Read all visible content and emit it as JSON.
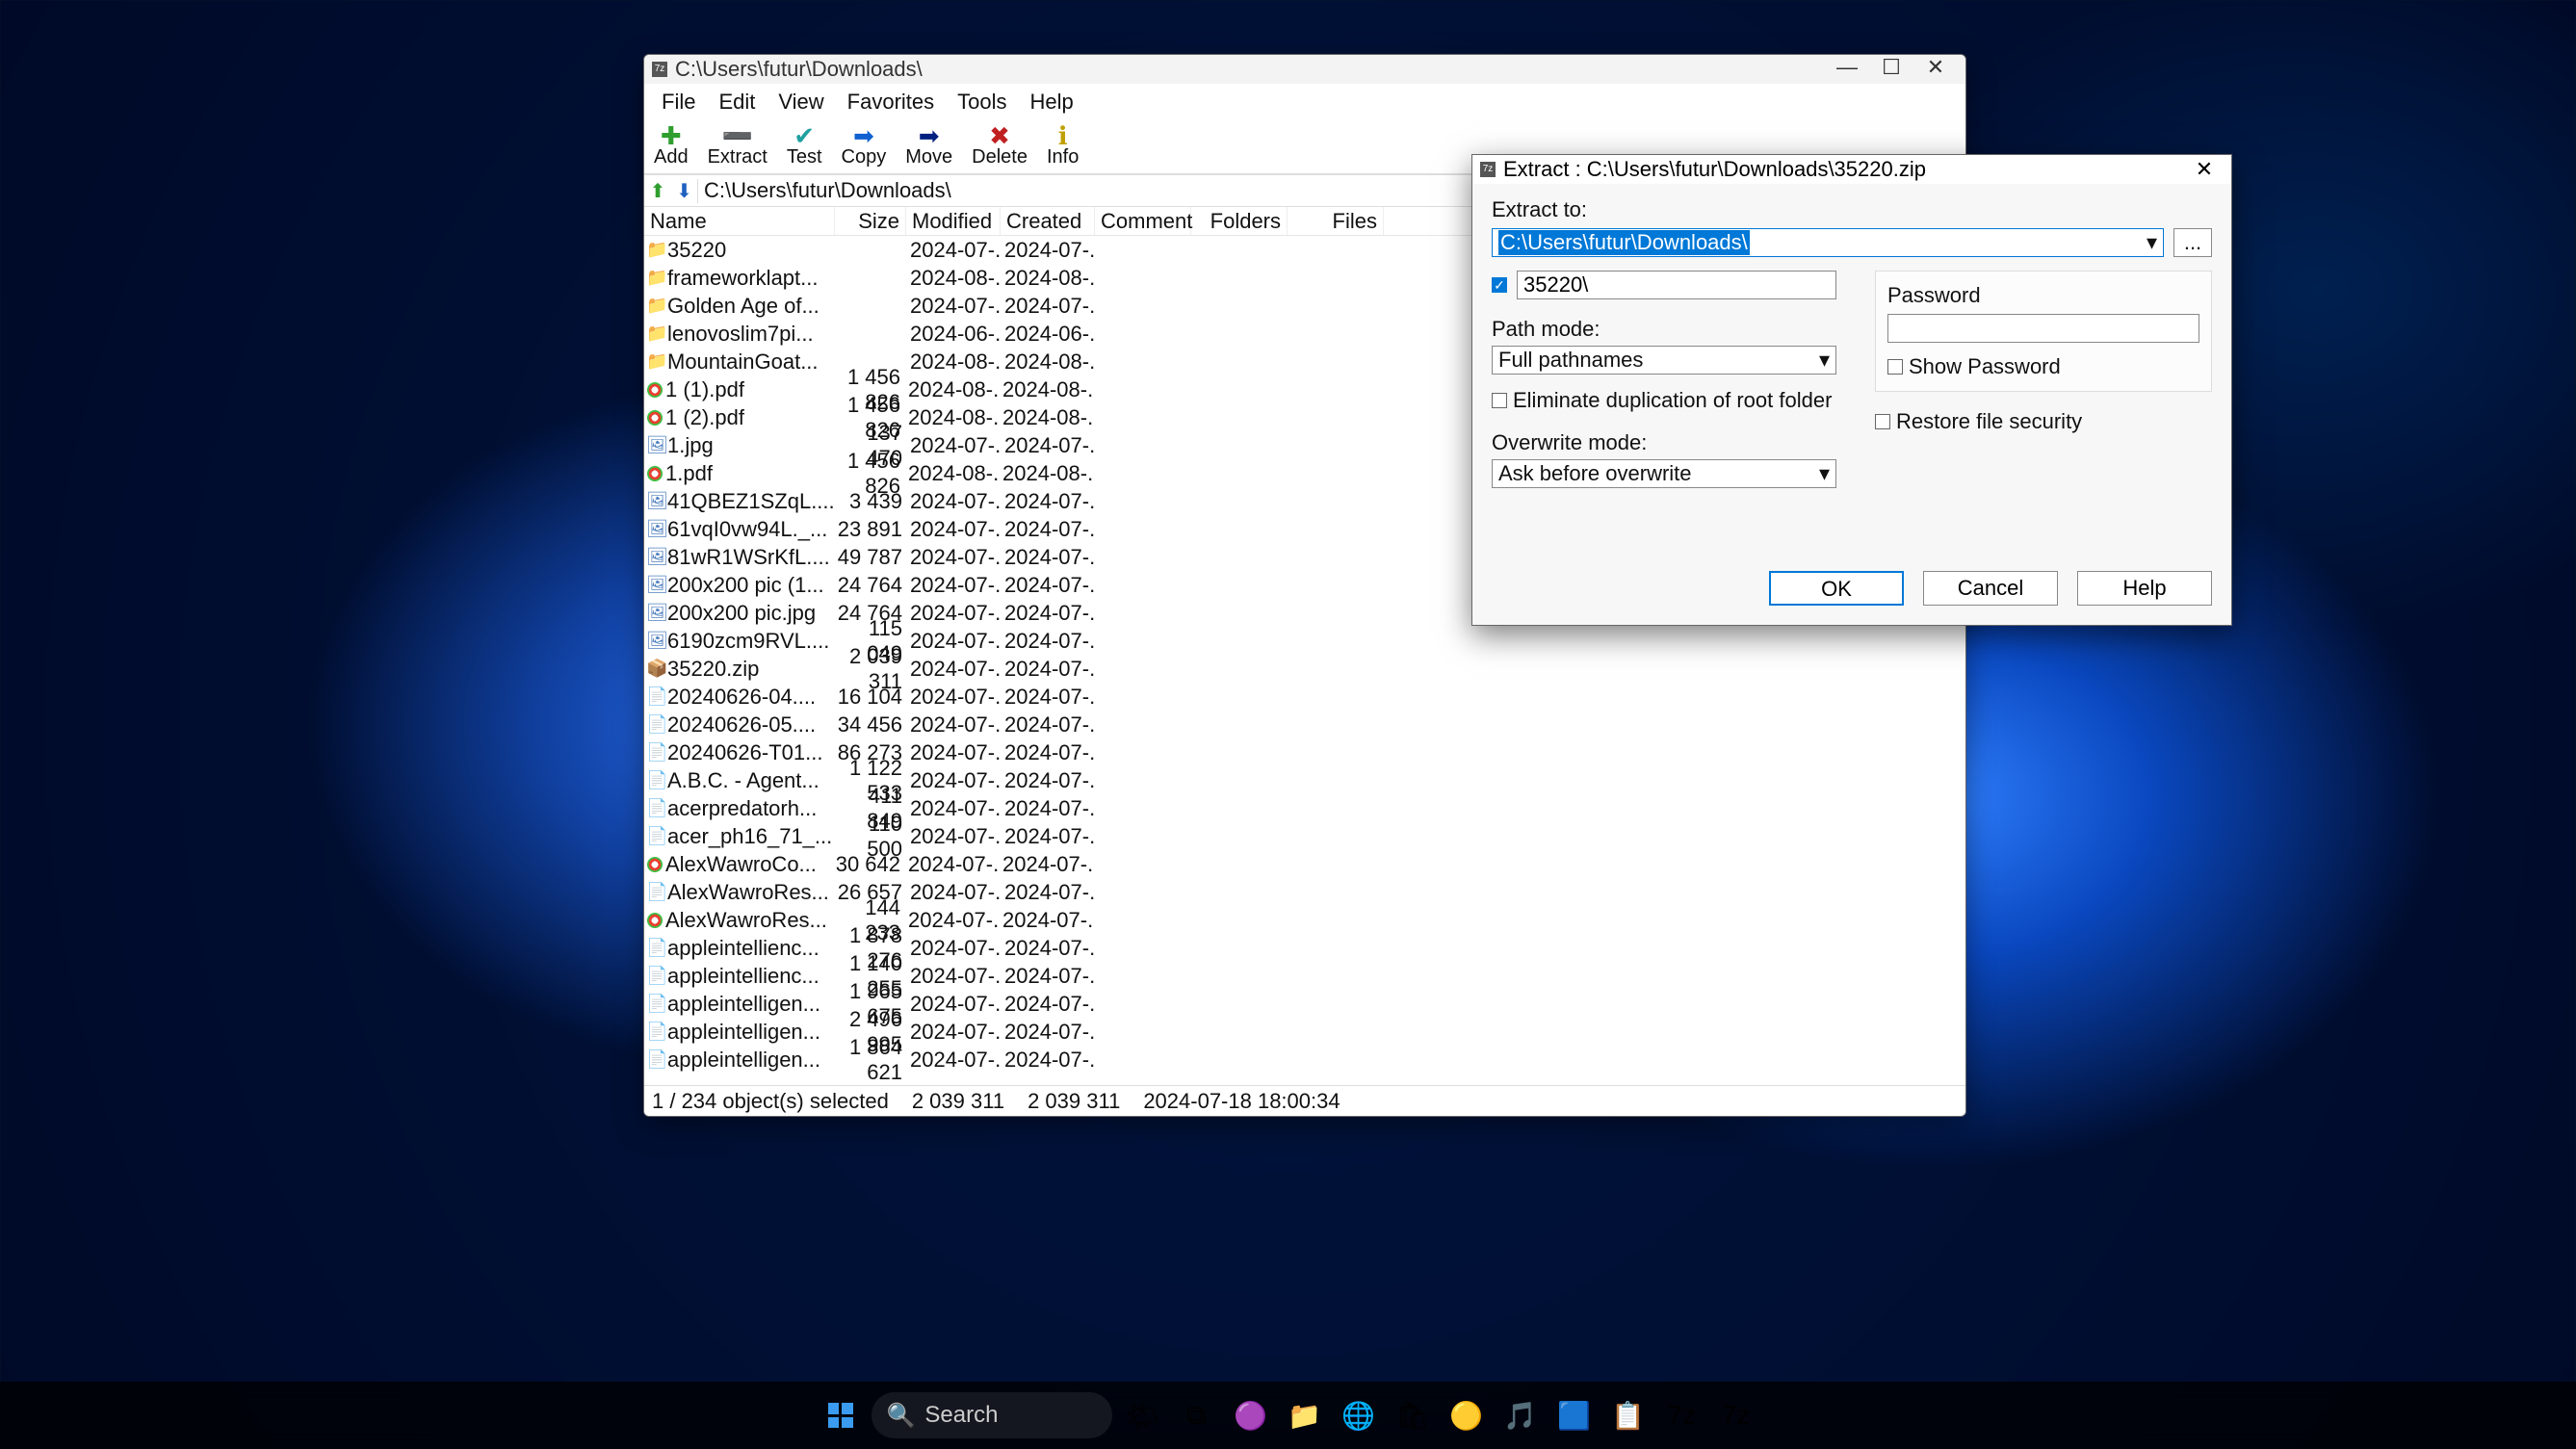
{
  "main": {
    "title": "C:\\Users\\futur\\Downloads\\",
    "menus": [
      "File",
      "Edit",
      "View",
      "Favorites",
      "Tools",
      "Help"
    ],
    "toolbar": [
      {
        "name": "add",
        "icon": "✚",
        "label": "Add"
      },
      {
        "name": "extract",
        "icon": "➖",
        "label": "Extract"
      },
      {
        "name": "test",
        "icon": "✔",
        "label": "Test"
      },
      {
        "name": "copy",
        "icon": "➡",
        "label": "Copy"
      },
      {
        "name": "move",
        "icon": "➡",
        "label": "Move"
      },
      {
        "name": "delete",
        "icon": "✖",
        "label": "Delete"
      },
      {
        "name": "info",
        "icon": "ℹ",
        "label": "Info"
      }
    ],
    "address": "C:\\Users\\futur\\Downloads\\",
    "columns": {
      "name": "Name",
      "size": "Size",
      "modified": "Modified",
      "created": "Created",
      "comment": "Comment",
      "folders": "Folders",
      "files": "Files"
    },
    "files": [
      {
        "icon": "folder",
        "name": "35220",
        "size": "",
        "mod": "2024-07-...",
        "cre": "2024-07-..."
      },
      {
        "icon": "folder",
        "name": "frameworklapt...",
        "size": "",
        "mod": "2024-08-...",
        "cre": "2024-08-..."
      },
      {
        "icon": "folder",
        "name": "Golden Age of...",
        "size": "",
        "mod": "2024-07-...",
        "cre": "2024-07-..."
      },
      {
        "icon": "folder",
        "name": "lenovoslim7pi...",
        "size": "",
        "mod": "2024-06-...",
        "cre": "2024-06-..."
      },
      {
        "icon": "folder",
        "name": "MountainGoat...",
        "size": "",
        "mod": "2024-08-...",
        "cre": "2024-08-..."
      },
      {
        "icon": "chrome",
        "name": "1 (1).pdf",
        "size": "1 456 826",
        "mod": "2024-08-...",
        "cre": "2024-08-..."
      },
      {
        "icon": "chrome",
        "name": "1 (2).pdf",
        "size": "1 456 826",
        "mod": "2024-08-...",
        "cre": "2024-08-..."
      },
      {
        "icon": "img",
        "name": "1.jpg",
        "size": "137 470",
        "mod": "2024-07-...",
        "cre": "2024-07-..."
      },
      {
        "icon": "chrome",
        "name": "1.pdf",
        "size": "1 456 826",
        "mod": "2024-08-...",
        "cre": "2024-08-..."
      },
      {
        "icon": "img",
        "name": "41QBEZ1SZqL....",
        "size": "3 439",
        "mod": "2024-07-...",
        "cre": "2024-07-..."
      },
      {
        "icon": "img",
        "name": "61vqI0vw94L._...",
        "size": "23 891",
        "mod": "2024-07-...",
        "cre": "2024-07-..."
      },
      {
        "icon": "img",
        "name": "81wR1WSrKfL....",
        "size": "49 787",
        "mod": "2024-07-...",
        "cre": "2024-07-..."
      },
      {
        "icon": "img",
        "name": "200x200 pic (1...",
        "size": "24 764",
        "mod": "2024-07-...",
        "cre": "2024-07-..."
      },
      {
        "icon": "img",
        "name": "200x200 pic.jpg",
        "size": "24 764",
        "mod": "2024-07-...",
        "cre": "2024-07-..."
      },
      {
        "icon": "img",
        "name": "6190zcm9RVL....",
        "size": "115 049",
        "mod": "2024-07-...",
        "cre": "2024-07-..."
      },
      {
        "icon": "zip",
        "name": "35220.zip",
        "size": "2 039 311",
        "mod": "2024-07-...",
        "cre": "2024-07-..."
      },
      {
        "icon": "txt",
        "name": "20240626-04....",
        "size": "16 104",
        "mod": "2024-07-...",
        "cre": "2024-07-..."
      },
      {
        "icon": "txt",
        "name": "20240626-05....",
        "size": "34 456",
        "mod": "2024-07-...",
        "cre": "2024-07-..."
      },
      {
        "icon": "txt",
        "name": "20240626-T01...",
        "size": "86 273",
        "mod": "2024-07-...",
        "cre": "2024-07-..."
      },
      {
        "icon": "txt",
        "name": "A.B.C. - Agent...",
        "size": "1 122 533",
        "mod": "2024-07-...",
        "cre": "2024-07-..."
      },
      {
        "icon": "txt",
        "name": "acerpredatorh...",
        "size": "411 849",
        "mod": "2024-07-...",
        "cre": "2024-07-..."
      },
      {
        "icon": "txt",
        "name": "acer_ph16_71_...",
        "size": "110 500",
        "mod": "2024-07-...",
        "cre": "2024-07-..."
      },
      {
        "icon": "chrome",
        "name": "AlexWawroCo...",
        "size": "30 642",
        "mod": "2024-07-...",
        "cre": "2024-07-..."
      },
      {
        "icon": "txt",
        "name": "AlexWawroRes...",
        "size": "26 657",
        "mod": "2024-07-...",
        "cre": "2024-07-..."
      },
      {
        "icon": "chrome",
        "name": "AlexWawroRes...",
        "size": "144 233",
        "mod": "2024-07-...",
        "cre": "2024-07-..."
      },
      {
        "icon": "txt",
        "name": "appleintellienc...",
        "size": "1 878 276",
        "mod": "2024-07-...",
        "cre": "2024-07-..."
      },
      {
        "icon": "txt",
        "name": "appleintellienc...",
        "size": "1 140 255",
        "mod": "2024-07-...",
        "cre": "2024-07-..."
      },
      {
        "icon": "txt",
        "name": "appleintelligen...",
        "size": "1 965 675",
        "mod": "2024-07-...",
        "cre": "2024-07-..."
      },
      {
        "icon": "txt",
        "name": "appleintelligen...",
        "size": "2 496 995",
        "mod": "2024-07-...",
        "cre": "2024-07-..."
      },
      {
        "icon": "txt",
        "name": "appleintelligen...",
        "size": "1 864 621",
        "mod": "2024-07-...",
        "cre": "2024-07-..."
      }
    ],
    "status": {
      "sel": "1 / 234 object(s) selected",
      "s1": "2 039 311",
      "s2": "2 039 311",
      "date": "2024-07-18 18:00:34"
    }
  },
  "dialog": {
    "title": "Extract : C:\\Users\\futur\\Downloads\\35220.zip",
    "extract_to_label": "Extract to:",
    "extract_to_value": "C:\\Users\\futur\\Downloads\\",
    "subfolder_checked": true,
    "subfolder_value": "35220\\",
    "path_mode_label": "Path mode:",
    "path_mode_value": "Full pathnames",
    "eliminate_label": "Eliminate duplication of root folder",
    "overwrite_label": "Overwrite mode:",
    "overwrite_value": "Ask before overwrite",
    "password_label": "Password",
    "show_password_label": "Show Password",
    "restore_label": "Restore file security",
    "ok": "OK",
    "cancel": "Cancel",
    "help": "Help"
  },
  "taskbar": {
    "search_placeholder": "Search"
  }
}
